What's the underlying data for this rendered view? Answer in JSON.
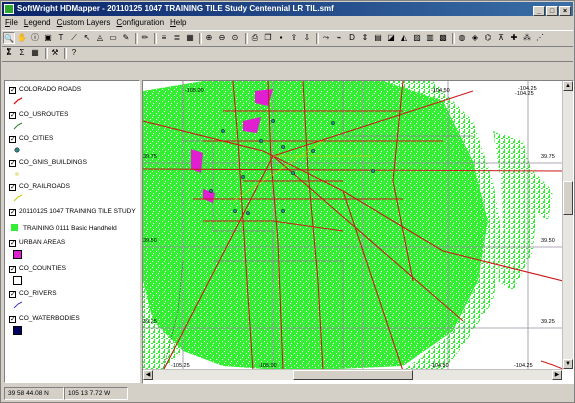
{
  "window": {
    "title": "SoftWright HDMapper - 20110125 1047 TRAINING TILE Study Centennial LR TIL.smf"
  },
  "menu": [
    "File",
    "Legend",
    "Custom Layers",
    "Configuration",
    "Help"
  ],
  "legend": {
    "items": [
      {
        "label": "COLORADO ROADS",
        "checked": true,
        "symbol": "road-line-icon",
        "color": "#e8121a"
      },
      {
        "label": "CO_USROUTES",
        "checked": true,
        "symbol": "route-line-icon",
        "color": "#2a7a2a"
      },
      {
        "label": "CO_CITIES",
        "checked": true,
        "symbol": "city-point-icon",
        "color": "#2a8a8a"
      },
      {
        "label": "CO_GNIS_BUILDINGS",
        "checked": true,
        "symbol": "building-point-icon",
        "color": "#e8e8a0"
      },
      {
        "label": "CO_RAILROADS",
        "checked": true,
        "symbol": "railroad-line-icon",
        "color": "#c8c800"
      },
      {
        "label": "20110125 1047 TRAINING TILE STUDY",
        "checked": true,
        "symbol": "",
        "color": ""
      },
      {
        "label": "TRAINING 0111 Basic Handheld",
        "checked": false,
        "symbol": "coverage-swatch-icon",
        "color": "#33ee33"
      },
      {
        "label": "URBAN AREAS",
        "checked": true,
        "symbol": "urban-swatch-icon",
        "color": "#e020d0"
      },
      {
        "label": "CO_COUNTIES",
        "checked": true,
        "symbol": "county-swatch-icon",
        "color": "#ffffff"
      },
      {
        "label": "CO_RIVERS",
        "checked": true,
        "symbol": "river-line-icon",
        "color": "#4040c0"
      },
      {
        "label": "CO_WATERBODIES",
        "checked": true,
        "symbol": "water-swatch-icon",
        "color": "#000060"
      }
    ]
  },
  "map": {
    "lat_labels": [
      "39.75",
      "39.50",
      "39.25"
    ],
    "lon_labels": [
      "-104.25",
      "-105.00",
      "-104.50",
      "-104.25",
      "-105.25",
      "-105.00",
      "-104.50",
      "-104.25"
    ],
    "colors": {
      "coverage": "#33ee33",
      "roads": "#cc1a1a",
      "urban": "#e020d0",
      "grid": "#9a8aa0"
    }
  },
  "status": {
    "lat": "39 58 44.08 N",
    "lon": "105 13 7.72 W"
  }
}
